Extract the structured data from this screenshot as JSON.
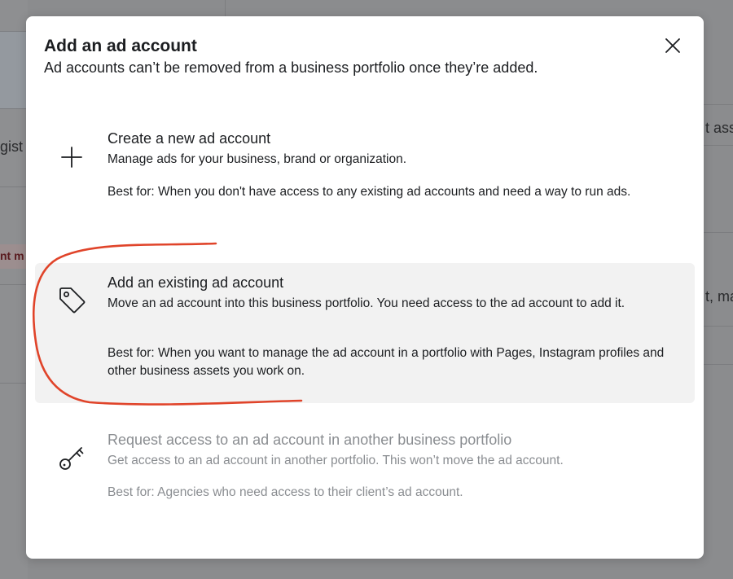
{
  "background": {
    "fragments": [
      "gist",
      "nt m",
      "t ass",
      "t, ma"
    ]
  },
  "modal": {
    "title": "Add an ad account",
    "subtitle": "Ad accounts can’t be removed from a business portfolio once they’re added.",
    "close_icon": "close-icon"
  },
  "options": [
    {
      "icon": "plus-icon",
      "title": "Create a new ad account",
      "description": "Manage ads for your business, brand or organization.",
      "best_for": "Best for: When you don't have access to any existing ad accounts and need a way to run ads.",
      "state": "default"
    },
    {
      "icon": "tag-icon",
      "title": "Add an existing ad account",
      "description": "Move an ad account into this business portfolio. You need access to the ad account to add it.",
      "best_for": "Best for: When you want to manage the ad account in a portfolio with Pages, Instagram profiles and other business assets you work on.",
      "state": "selected"
    },
    {
      "icon": "key-icon",
      "title": "Request access to an ad account in another business portfolio",
      "description": "Get access to an ad account in another portfolio. This won’t move the ad account.",
      "best_for": "Best for: Agencies who need access to their client’s ad account.",
      "state": "disabled"
    }
  ],
  "colors": {
    "annotation": "#e0442a",
    "selected_bg": "#f2f2f2",
    "disabled_text": "#8a8d91"
  }
}
